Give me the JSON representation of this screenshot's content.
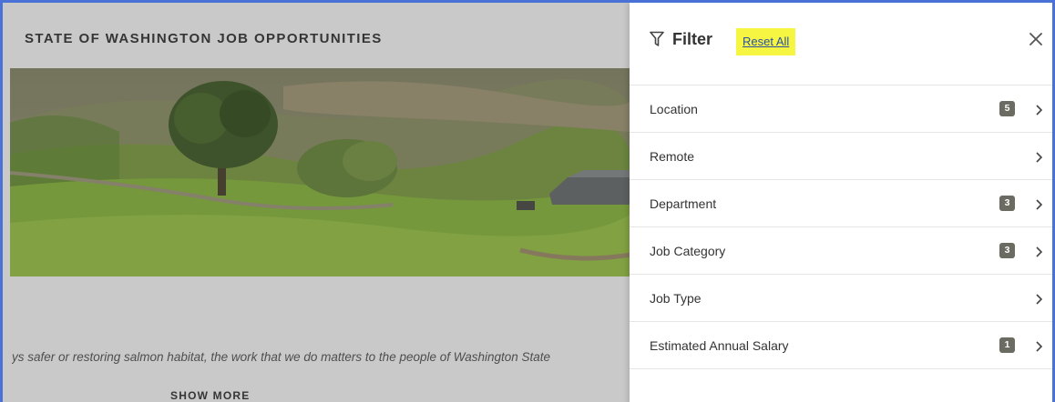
{
  "page": {
    "title": "STATE OF WASHINGTON JOB OPPORTUNITIES",
    "intro_text": "ys safer or restoring salmon habitat, the work that we do matters to the people of Washington State",
    "show_more_label": "SHOW MORE"
  },
  "filter_panel": {
    "title": "Filter",
    "reset_label": "Reset All",
    "close_icon": "close-icon",
    "filter_icon": "funnel-icon",
    "rows": [
      {
        "label": "Location",
        "badge": "5"
      },
      {
        "label": "Remote",
        "badge": ""
      },
      {
        "label": "Department",
        "badge": "3"
      },
      {
        "label": "Job Category",
        "badge": "3"
      },
      {
        "label": "Job Type",
        "badge": ""
      },
      {
        "label": "Estimated Annual Salary",
        "badge": "1"
      }
    ]
  },
  "colors": {
    "frame_border": "#4a72d6",
    "reset_highlight": "#f5f542",
    "badge_bg": "#6b6b62",
    "link": "#2c4fa8"
  }
}
